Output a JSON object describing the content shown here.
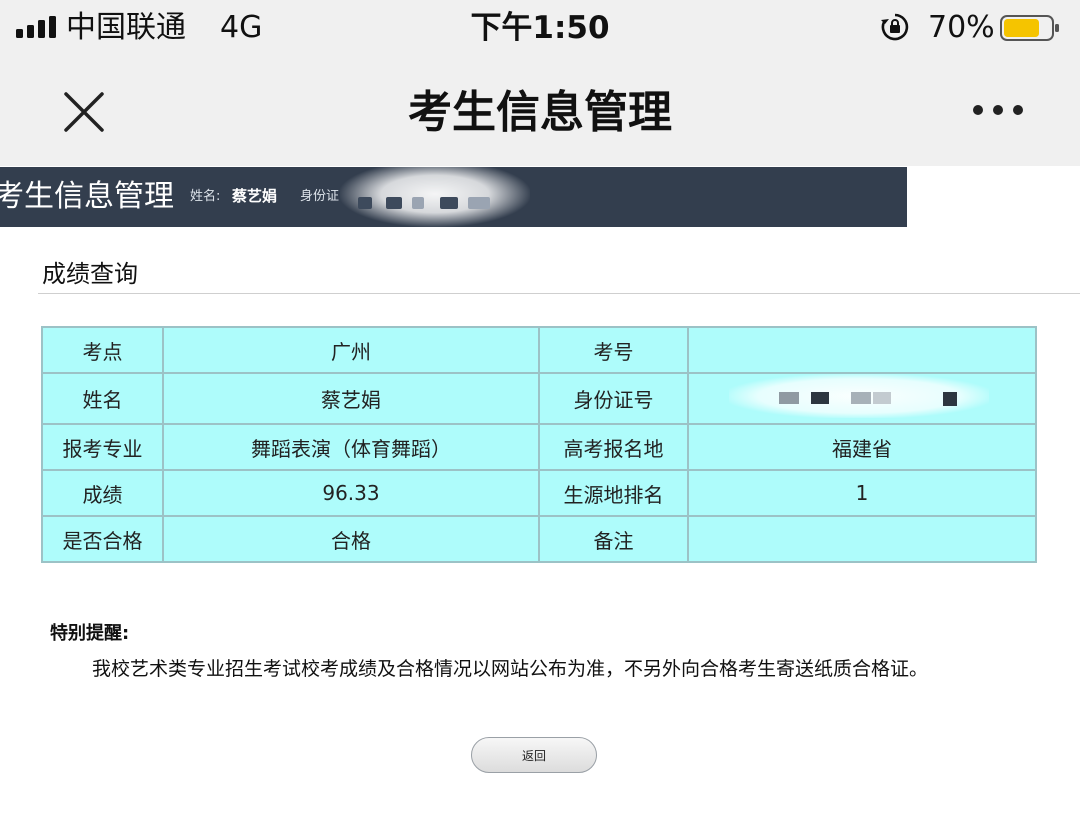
{
  "status_bar": {
    "carrier": "中国联通",
    "network": "4G",
    "time": "下午1:50",
    "battery_percent": "70%",
    "battery_color": "#f5c400"
  },
  "nav_bar": {
    "title": "考生信息管理",
    "close_icon": "close-icon",
    "more_icon": "more-icon"
  },
  "site_header": {
    "title": "考生信息管理",
    "name_label": "姓名:",
    "name_value": "蔡艺娟",
    "id_label": "身份证",
    "background_color": "#333e4e"
  },
  "section": {
    "title": "成绩查询"
  },
  "score_table": {
    "background_color": "#aefcfb",
    "rows": [
      {
        "label1": "考点",
        "value1": "广州",
        "label2": "考号",
        "value2": ""
      },
      {
        "label1": "姓名",
        "value1": "蔡艺娟",
        "label2": "身份证号",
        "value2": ""
      },
      {
        "label1": "报考专业",
        "value1": "舞蹈表演（体育舞蹈）",
        "label2": "高考报名地",
        "value2": "福建省"
      },
      {
        "label1": "成绩",
        "value1": "96.33",
        "label2": "生源地排名",
        "value2": "1"
      },
      {
        "label1": "是否合格",
        "value1": "合格",
        "label2": "备注",
        "value2": ""
      }
    ]
  },
  "notice": {
    "title": "特别提醒:",
    "body": "我校艺术类专业招生考试校考成绩及合格情况以网站公布为准，不另外向合格考生寄送纸质合格证。"
  },
  "back_button": {
    "label": "返回"
  }
}
